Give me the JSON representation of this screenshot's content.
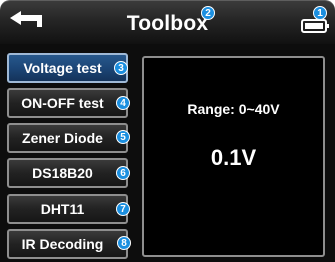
{
  "header": {
    "title": "Toolbox",
    "back_icon": "back-arrow-icon",
    "battery_icon": "battery-icon"
  },
  "menu": {
    "items": [
      {
        "label": "Voltage test",
        "callout": "3",
        "active": true
      },
      {
        "label": "ON-OFF test",
        "callout": "4",
        "active": false
      },
      {
        "label": "Zener Diode",
        "callout": "5",
        "active": false
      },
      {
        "label": "DS18B20",
        "callout": "6",
        "active": false
      },
      {
        "label": "DHT11",
        "callout": "7",
        "active": false
      },
      {
        "label": "IR Decoding",
        "callout": "8",
        "active": false
      }
    ]
  },
  "display": {
    "range": "Range: 0~40V",
    "reading": "0.1V"
  },
  "callouts": {
    "battery": "1",
    "title": "2"
  },
  "colors": {
    "active_button": "#1c4677",
    "callout_blue": "#1b8fe0",
    "background": "#0d0d0d"
  }
}
